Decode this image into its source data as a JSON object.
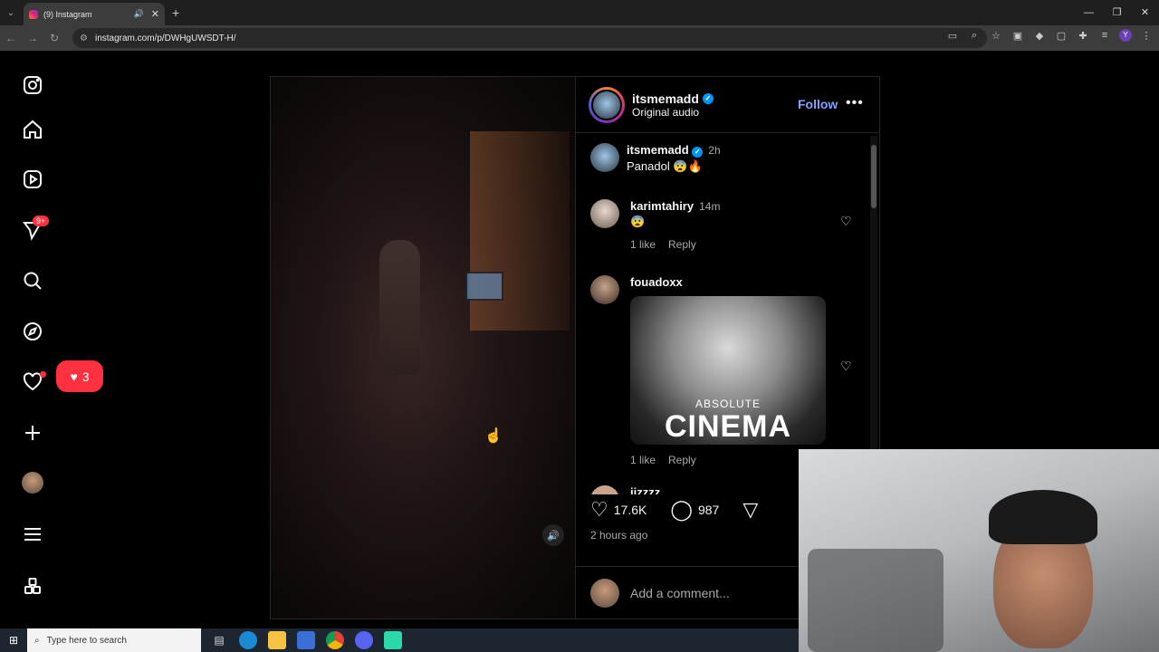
{
  "browser": {
    "tab_title": "(9) Instagram",
    "url": "instagram.com/p/DWHgUWSDT-H/",
    "new_tab": "+",
    "controls": [
      "—",
      "❐",
      "✕"
    ]
  },
  "sidebar": {
    "messages_badge": "9+",
    "notification_count": "3"
  },
  "post": {
    "author": "itsmemadd",
    "audio": "Original audio",
    "follow_label": "Follow",
    "more_label": "•••",
    "caption": {
      "user": "itsmemadd",
      "time": "2h",
      "text": "Panadol 😨🔥"
    },
    "comments": [
      {
        "user": "karimtahiry",
        "time": "14m",
        "text": "😨",
        "likes": "1 like",
        "reply": "Reply"
      },
      {
        "user": "fouadoxx",
        "time": "",
        "gif_line1": "ABSOLUTE",
        "gif_line2": "CINEMA",
        "likes": "1 like",
        "reply": "Reply"
      }
    ],
    "partial_user": "jizzzz",
    "like_count": "17.6K",
    "comment_count": "987",
    "posted": "2 hours ago",
    "add_comment_placeholder": "Add a comment..."
  },
  "taskbar": {
    "search_placeholder": "Type here to search"
  },
  "colors": {
    "accent": "#0095f6",
    "follow": "#85a1ff",
    "notification": "#ff3040"
  }
}
